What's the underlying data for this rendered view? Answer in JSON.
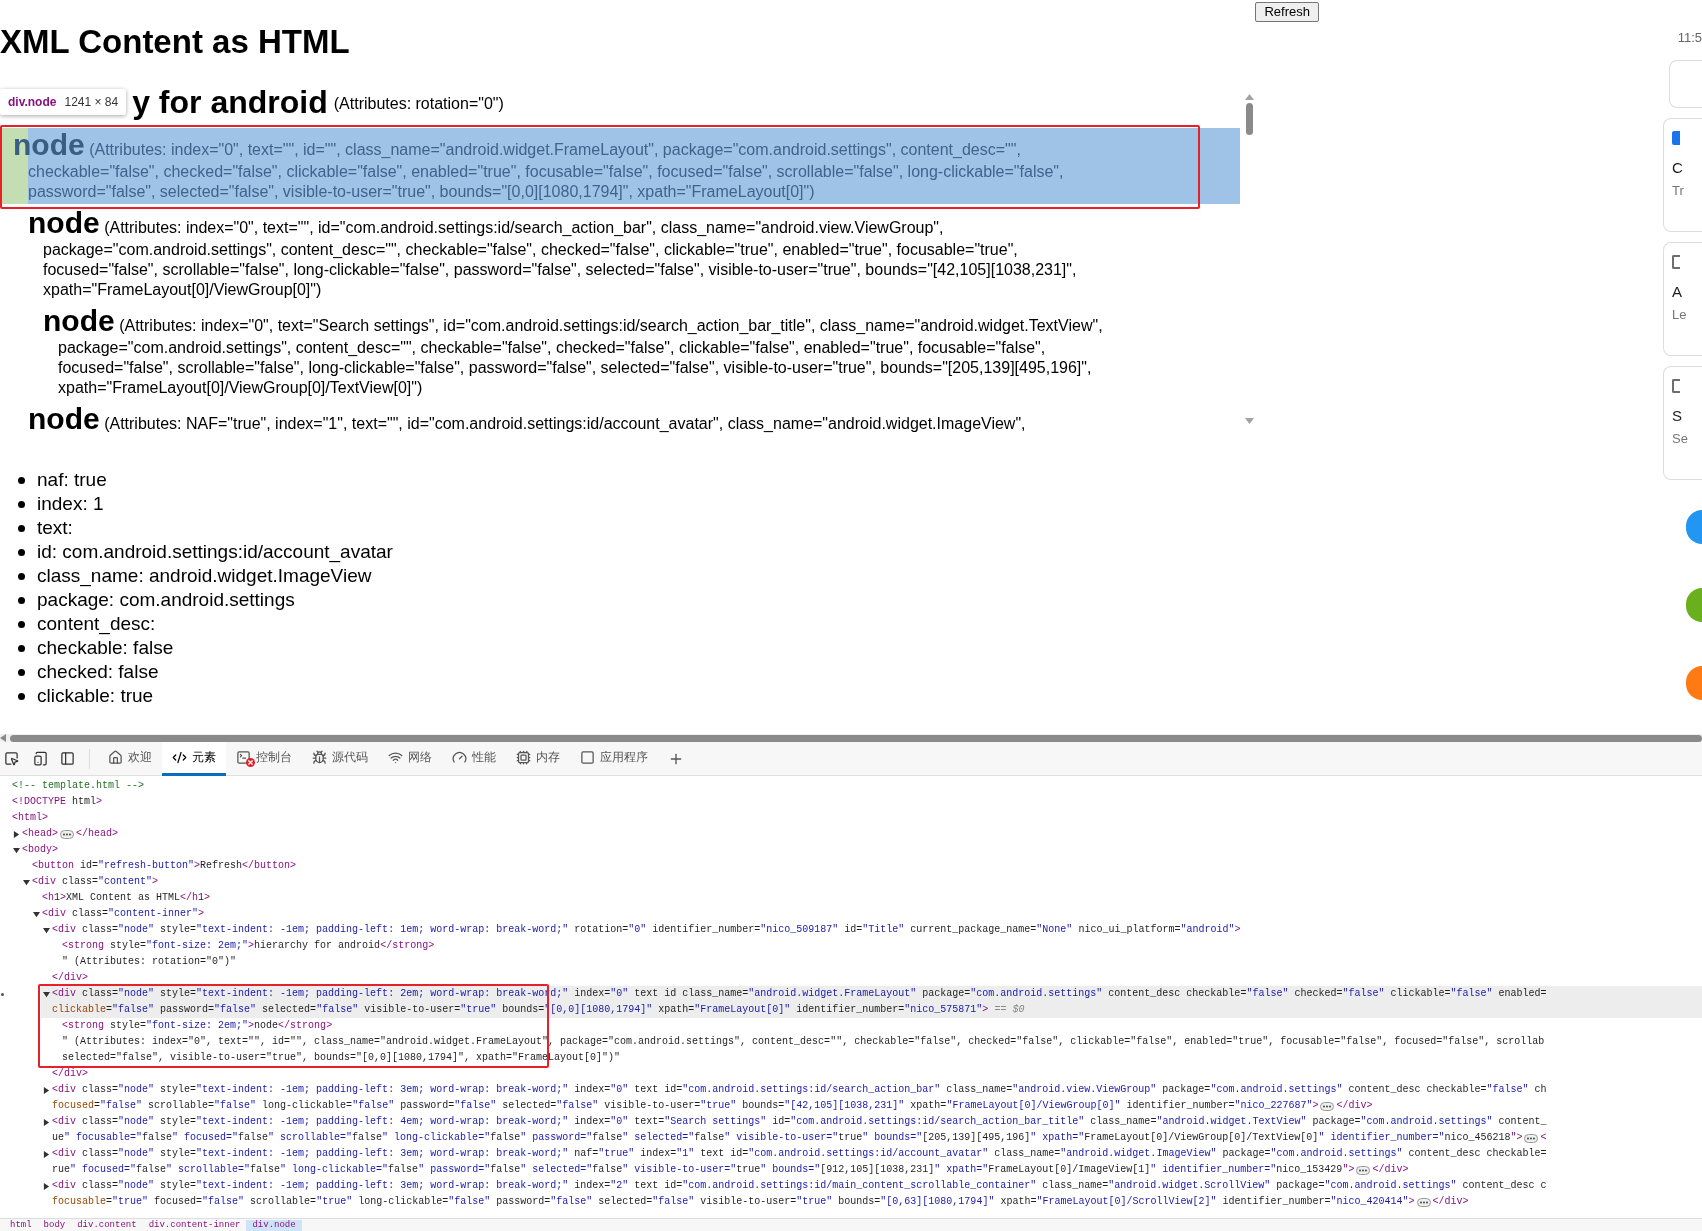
{
  "page": {
    "refresh_button": "Refresh",
    "title": "XML Content as HTML",
    "inspector_tooltip": {
      "selector": "div.node",
      "size": "1241 × 84"
    },
    "hierarchy": {
      "heading": "y for android",
      "attributes": "(Attributes: rotation=\"0\")"
    },
    "nodes": [
      {
        "tag": "node",
        "highlighted": true,
        "attributes": "(Attributes: index=\"0\", text=\"\", id=\"\", class_name=\"android.widget.FrameLayout\", package=\"com.android.settings\", content_desc=\"\", checkable=\"false\", checked=\"false\", clickable=\"false\", enabled=\"true\", focusable=\"false\", focused=\"false\", scrollable=\"false\", long-clickable=\"false\", password=\"false\", selected=\"false\", visible-to-user=\"true\", bounds=\"[0,0][1080,1794]\", xpath=\"FrameLayout[0]\")",
        "children": [
          {
            "tag": "node",
            "highlighted": false,
            "attributes": "(Attributes: index=\"0\", text=\"\", id=\"com.android.settings:id/search_action_bar\", class_name=\"android.view.ViewGroup\", package=\"com.android.settings\", content_desc=\"\", checkable=\"false\", checked=\"false\", clickable=\"true\", enabled=\"true\", focusable=\"true\", focused=\"false\", scrollable=\"false\", long-clickable=\"false\", password=\"false\", selected=\"false\", visible-to-user=\"true\", bounds=\"[42,105][1038,231]\", xpath=\"FrameLayout[0]/ViewGroup[0]\")",
            "children": [
              {
                "tag": "node",
                "highlighted": false,
                "attributes": "(Attributes: index=\"0\", text=\"Search settings\", id=\"com.android.settings:id/search_action_bar_title\", class_name=\"android.widget.TextView\", package=\"com.android.settings\", content_desc=\"\", checkable=\"false\", checked=\"false\", clickable=\"false\", enabled=\"true\", focusable=\"false\", focused=\"false\", scrollable=\"false\", long-clickable=\"false\", password=\"false\", selected=\"false\", visible-to-user=\"true\", bounds=\"[205,139][495,196]\", xpath=\"FrameLayout[0]/ViewGroup[0]/TextView[0]\")"
              }
            ]
          },
          {
            "tag": "node",
            "highlighted": false,
            "attributes": "(Attributes: NAF=\"true\", index=\"1\", text=\"\", id=\"com.android.settings:id/account_avatar\", class_name=\"android.widget.ImageView\","
          }
        ]
      }
    ],
    "details": [
      "naf: true",
      "index: 1",
      "text:",
      "id: com.android.settings:id/account_avatar",
      "class_name: android.widget.ImageView",
      "package: com.android.settings",
      "content_desc:",
      "checkable: false",
      "checked: false",
      "clickable: true"
    ]
  },
  "phone_preview": {
    "time": "11:5",
    "cards": [
      {
        "kind": "blank"
      },
      {
        "kind": "labeled",
        "title": "C",
        "subtitle": "Tr"
      },
      {
        "kind": "labeled",
        "title": "A",
        "subtitle": "Le"
      },
      {
        "kind": "labeled",
        "title": "S",
        "subtitle": "Se"
      }
    ],
    "shortcuts": [
      {
        "color": "#2196f3"
      },
      {
        "color": "#6aaf1e"
      },
      {
        "color": "#ff7a12"
      }
    ]
  },
  "devtools": {
    "tabs": [
      {
        "label": "欢迎",
        "selected": false,
        "errors": false
      },
      {
        "label": "元素",
        "selected": true,
        "errors": false
      },
      {
        "label": "控制台",
        "selected": false,
        "errors": true
      },
      {
        "label": "源代码",
        "selected": false,
        "errors": false
      },
      {
        "label": "网络",
        "selected": false,
        "errors": false
      },
      {
        "label": "性能",
        "selected": false,
        "errors": false
      },
      {
        "label": "内存",
        "selected": false,
        "errors": false
      },
      {
        "label": "应用程序",
        "selected": false,
        "errors": false
      }
    ],
    "dom_tree": [
      {
        "kind": "comment",
        "lines": [
          "<!-- template.html -->"
        ]
      },
      {
        "kind": "tag",
        "lines": [
          "<!DOCTYPE html>"
        ]
      },
      {
        "kind": "tag",
        "lines": [
          "<html>"
        ],
        "children": [
          {
            "kind": "tag",
            "lines": [
              "<head>"
            ],
            "expanded": false,
            "tail": "</head>"
          },
          {
            "kind": "tag",
            "lines": [
              "<body>"
            ],
            "expanded": true,
            "children": [
              {
                "kind": "tag",
                "lines": [
                  "<button id=\"refresh-button\">Refresh</button>"
                ]
              },
              {
                "kind": "tag",
                "lines": [
                  "<div class=\"content\">"
                ],
                "expanded": true,
                "children": [
                  {
                    "kind": "tag",
                    "lines": [
                      "<h1>XML Content as HTML</h1>"
                    ]
                  },
                  {
                    "kind": "tag",
                    "lines": [
                      "<div class=\"content-inner\">"
                    ],
                    "expanded": true,
                    "children": [
                      {
                        "kind": "tag",
                        "lines": [
                          "<div class=\"node\" style=\"text-indent: -1em; padding-left: 1em; word-wrap: break-word;\" rotation=\"0\" identifier_number=\"nico_509187\" id=\"Title\" current_package_name=\"None\" nico_ui_platform=\"android\">"
                        ],
                        "expanded": true,
                        "closing": "</div>",
                        "children": [
                          {
                            "kind": "tag",
                            "lines": [
                              "<strong style=\"font-size: 2em;\">hierarchy for android</strong>"
                            ]
                          },
                          {
                            "kind": "text",
                            "lines": [
                              "\" (Attributes: rotation=\"0\")\""
                            ]
                          }
                        ]
                      },
                      {
                        "kind": "tag",
                        "selected": true,
                        "suffix": "== $0",
                        "lines": [
                          "<div class=\"node\" style=\"text-indent: -1em; padding-left: 2em; word-wrap: break-word;\" index=\"0\" text id class_name=\"android.widget.FrameLayout\" package=\"com.android.settings\" content_desc checkable=\"false\" checked=\"false\" clickable=\"false\" enabled=",
                          "clickable=\"false\" password=\"false\" selected=\"false\" visible-to-user=\"true\" bounds=\"[0,0][1080,1794]\" xpath=\"FrameLayout[0]\" identifier_number=\"nico_575871\">"
                        ],
                        "expanded": true,
                        "closing": "</div>",
                        "children": [
                          {
                            "kind": "tag",
                            "lines": [
                              "<strong style=\"font-size: 2em;\">node</strong>"
                            ]
                          },
                          {
                            "kind": "text",
                            "lines": [
                              "\" (Attributes: index=\"0\", text=\"\", id=\"\", class_name=\"android.widget.FrameLayout\", package=\"com.android.settings\", content_desc=\"\", checkable=\"false\", checked=\"false\", clickable=\"false\", enabled=\"true\", focusable=\"false\", focused=\"false\", scrollab",
                              "selected=\"false\", visible-to-user=\"true\", bounds=\"[0,0][1080,1794]\", xpath=\"FrameLayout[0]\")\""
                            ]
                          }
                        ]
                      },
                      {
                        "kind": "tag",
                        "lines": [
                          "<div class=\"node\" style=\"text-indent: -1em; padding-left: 3em; word-wrap: break-word;\" index=\"0\" text id=\"com.android.settings:id/search_action_bar\" class_name=\"android.view.ViewGroup\" package=\"com.android.settings\" content_desc checkable=\"false\" ch",
                          "focused=\"false\" scrollable=\"false\" long-clickable=\"false\" password=\"false\" selected=\"false\" visible-to-user=\"true\" bounds=\"[42,105][1038,231]\" xpath=\"FrameLayout[0]/ViewGroup[0]\" identifier_number=\"nico_227687\">"
                        ],
                        "expanded": false,
                        "tail": "</div>"
                      },
                      {
                        "kind": "tag",
                        "lines": [
                          "<div class=\"node\" style=\"text-indent: -1em; padding-left: 4em; word-wrap: break-word;\" index=\"0\" text=\"Search settings\" id=\"com.android.settings:id/search_action_bar_title\" class_name=\"android.widget.TextView\" package=\"com.android.settings\" content_",
                          "ue\" focusable=\"false\" focused=\"false\" scrollable=\"false\" long-clickable=\"false\" password=\"false\" selected=\"false\" visible-to-user=\"true\" bounds=\"[205,139][495,196]\" xpath=\"FrameLayout[0]/ViewGroup[0]/TextView[0]\" identifier_number=\"nico_456218\">"
                        ],
                        "expanded": false,
                        "tail": "<"
                      },
                      {
                        "kind": "tag",
                        "lines": [
                          "<div class=\"node\" style=\"text-indent: -1em; padding-left: 3em; word-wrap: break-word;\" naf=\"true\" index=\"1\" text id=\"com.android.settings:id/account_avatar\" class_name=\"android.widget.ImageView\" package=\"com.android.settings\" content_desc checkable=",
                          "rue\" focused=\"false\" scrollable=\"false\" long-clickable=\"false\" password=\"false\" selected=\"false\" visible-to-user=\"true\" bounds=\"[912,105][1038,231]\" xpath=\"FrameLayout[0]/ImageView[1]\" identifier_number=\"nico_153429\">"
                        ],
                        "expanded": false,
                        "tail": "</div>"
                      },
                      {
                        "kind": "tag",
                        "lines": [
                          "<div class=\"node\" style=\"text-indent: -1em; padding-left: 3em; word-wrap: break-word;\" index=\"2\" text id=\"com.android.settings:id/main_content_scrollable_container\" class_name=\"android.widget.ScrollView\" package=\"com.android.settings\" content_desc c",
                          "focusable=\"true\" focused=\"false\" scrollable=\"true\" long-clickable=\"false\" password=\"false\" selected=\"false\" visible-to-user=\"true\" bounds=\"[0,63][1080,1794]\" xpath=\"FrameLayout[0]/ScrollView[2]\" identifier_number=\"nico_420414\">"
                        ],
                        "expanded": false,
                        "tail": "</div>"
                      }
                    ]
                  }
                ]
              }
            ]
          }
        ]
      }
    ],
    "breadcrumbs": [
      {
        "label": "html",
        "selected": false
      },
      {
        "label": "body",
        "selected": false
      },
      {
        "label": "div.content",
        "selected": false
      },
      {
        "label": "div.content-inner",
        "selected": false
      },
      {
        "label": "div.node",
        "selected": true
      }
    ]
  }
}
